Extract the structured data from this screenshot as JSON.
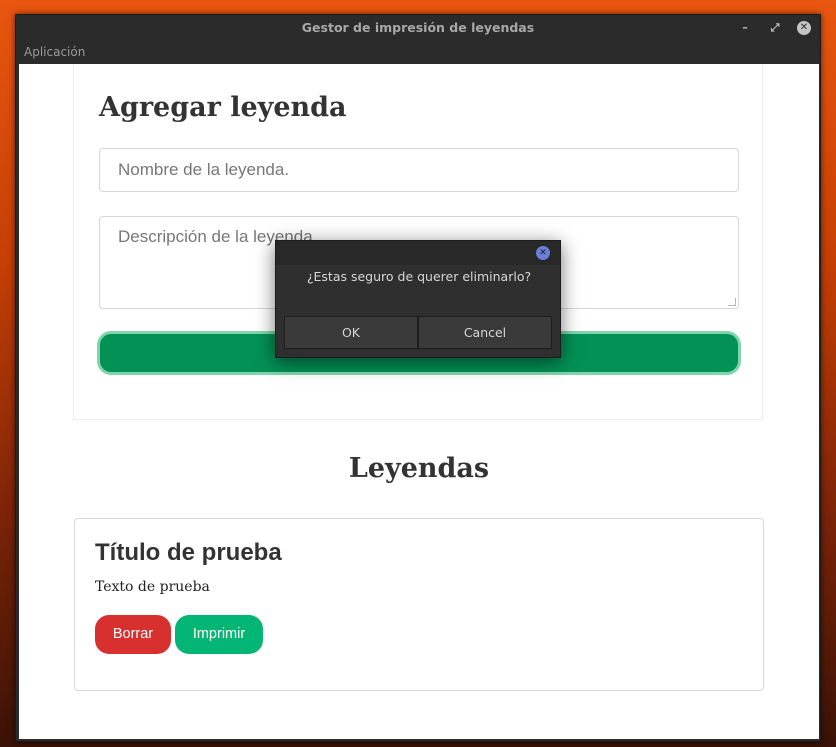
{
  "window": {
    "title": "Gestor de impresión de leyendas",
    "menu": "Aplicación"
  },
  "form": {
    "title": "Agregar leyenda",
    "name_placeholder": "Nombre de la leyenda.",
    "description_placeholder": "Descripción de la leyenda."
  },
  "list": {
    "title": "Leyendas",
    "cards": [
      {
        "title": "Título de prueba",
        "text": "Texto de prueba",
        "delete_label": "Borrar",
        "print_label": "Imprimir"
      }
    ]
  },
  "dialog": {
    "message": "¿Estas seguro de querer eliminarlo?",
    "ok_label": "OK",
    "cancel_label": "Cancel"
  },
  "colors": {
    "primary_green": "#039156",
    "accent_green": "#04b675",
    "danger_red": "#d7302f"
  }
}
